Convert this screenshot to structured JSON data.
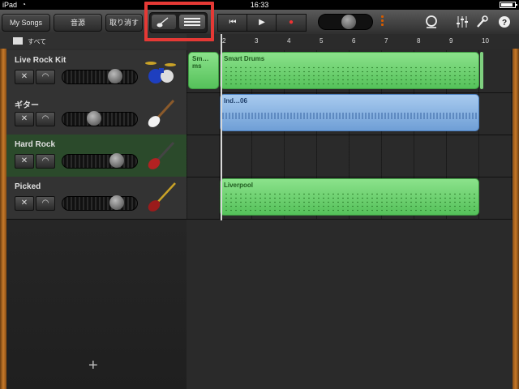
{
  "status_bar": {
    "device": "iPad",
    "wifi_icon": "wifi-icon",
    "time": "16:33"
  },
  "toolbar": {
    "my_songs": "My Songs",
    "instruments": "音源",
    "undo": "取り消す",
    "view_toggle": {
      "instrument_icon": "guitar-icon",
      "tracks_icon": "tracks-list-icon"
    },
    "transport": {
      "rewind": "⏮",
      "play": "▶",
      "record": "●"
    },
    "right_icons": [
      "loop-icon",
      "mixer-icon",
      "wrench-icon",
      "help-icon"
    ]
  },
  "track_header": {
    "all_label": "すべて"
  },
  "ruler": {
    "bars": [
      "2",
      "3",
      "4",
      "5",
      "6",
      "7",
      "8",
      "9",
      "10"
    ]
  },
  "tracks": [
    {
      "name": "Live Rock Kit",
      "instrument": "drum-kit-icon",
      "volume": 0.85
    },
    {
      "name": "ギター",
      "instrument": "guitar-icon",
      "volume": 0.42
    },
    {
      "name": "Hard Rock",
      "instrument": "guitar-icon",
      "volume": 0.8,
      "selected": true
    },
    {
      "name": "Picked",
      "instrument": "bass-guitar-icon",
      "volume": 0.8
    }
  ],
  "regions": [
    {
      "track": 0,
      "label": "Sm…ms"
    },
    {
      "track": 0,
      "label": "Smart Drums"
    },
    {
      "track": 1,
      "label": "Ind…06"
    },
    {
      "track": 3,
      "label": "Liverpool"
    }
  ],
  "add_track": "+",
  "colors": {
    "accent_red": "#e53935",
    "region_green": "#5fcf66",
    "region_blue": "#7aa9dc",
    "wood": "#c87a2a"
  }
}
